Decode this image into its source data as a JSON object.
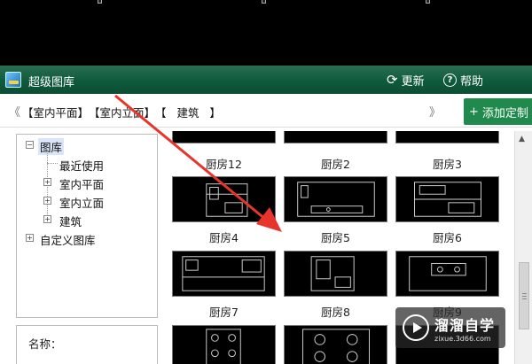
{
  "window": {
    "title": "超级图库"
  },
  "toolbar": {
    "refresh_label": "更新",
    "help_label": "帮助"
  },
  "pathbar": {
    "back_arrow": "《",
    "forward_arrow": "》",
    "crumbs": [
      "【室内平面】",
      "【室内立面】",
      "【   建筑   】"
    ],
    "add_button_label": "添加定制"
  },
  "tree": {
    "root": "图库",
    "children": [
      "最近使用",
      "室内平面",
      "室内立面",
      "建筑"
    ],
    "custom": "自定义图库"
  },
  "name_panel": {
    "label": "名称："
  },
  "thumbnails": [
    "厨房12",
    "厨房2",
    "厨房3",
    "厨房4",
    "厨房5",
    "厨房6",
    "厨房7",
    "厨房8",
    "厨房9",
    "",
    "",
    ""
  ],
  "watermark": {
    "title": "溜溜自学",
    "url": "zixue.3d66.com"
  },
  "colors": {
    "titlebar": "#0f5a3c",
    "accent_button": "#1f8a4c",
    "annotation_arrow": "#e8342a"
  }
}
